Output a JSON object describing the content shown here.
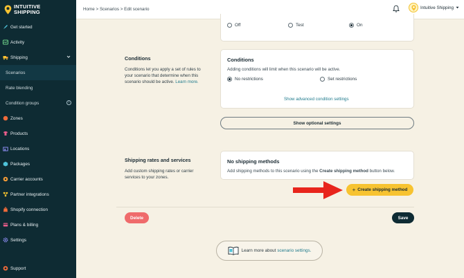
{
  "brand": {
    "line1": "INTUITIVE",
    "line2": "SHIPPING"
  },
  "sidebar": {
    "items": [
      {
        "label": "Get started",
        "icon": "rocket-icon"
      },
      {
        "label": "Activity",
        "icon": "activity-icon"
      },
      {
        "label": "Shipping",
        "icon": "shipping-icon"
      },
      {
        "label": "Scenarios"
      },
      {
        "label": "Rate blending"
      },
      {
        "label": "Condition groups"
      },
      {
        "label": "Zones",
        "icon": "zones-icon"
      },
      {
        "label": "Products",
        "icon": "products-icon"
      },
      {
        "label": "Locations",
        "icon": "locations-icon"
      },
      {
        "label": "Packages",
        "icon": "packages-icon"
      },
      {
        "label": "Carrier accounts",
        "icon": "carrier-icon"
      },
      {
        "label": "Partner integrations",
        "icon": "partner-icon"
      },
      {
        "label": "Shopify connection",
        "icon": "shopify-icon"
      },
      {
        "label": "Plans & billing",
        "icon": "billing-icon"
      },
      {
        "label": "Settings",
        "icon": "gear-icon"
      }
    ],
    "support": "Support"
  },
  "topbar": {
    "breadcrumb": "Home > Scenarios > Edit scenario",
    "account": "Intuitive Shipping"
  },
  "status_options": [
    {
      "label": "Off",
      "checked": false
    },
    {
      "label": "Test",
      "checked": false
    },
    {
      "label": "On",
      "checked": true
    }
  ],
  "conditions": {
    "section_title": "Conditions",
    "section_desc": "Conditions let you apply a set of rules to your scenario that determine when this scenario should be active.",
    "learn_more": "Learn more.",
    "card_title": "Conditions",
    "card_text": "Adding conditions will limit when this scenario will be active.",
    "options": [
      {
        "label": "No restrictions",
        "checked": true
      },
      {
        "label": "Set restrictions",
        "checked": false
      }
    ],
    "advanced_link": "Show advanced condition settings"
  },
  "optional_button": "Show optional settings",
  "rates": {
    "section_title": "Shipping rates and services",
    "section_desc": "Add custom shipping rates or carrier services to your zones.",
    "card_title": "No shipping methods",
    "card_text_pre": "Add shipping methods to this scenario using the ",
    "card_text_bold": "Create shipping method",
    "card_text_post": " button below.",
    "create_button": "Create shipping method"
  },
  "actions": {
    "delete": "Delete",
    "save": "Save"
  },
  "learn": {
    "pre": "Learn more about",
    "link": "scenario settings."
  },
  "colors": {
    "sidebar": "#0e2b33",
    "accent": "#f7c331",
    "danger": "#ef6b6b",
    "arrow": "#e8251c",
    "link": "#1f7a8c"
  }
}
